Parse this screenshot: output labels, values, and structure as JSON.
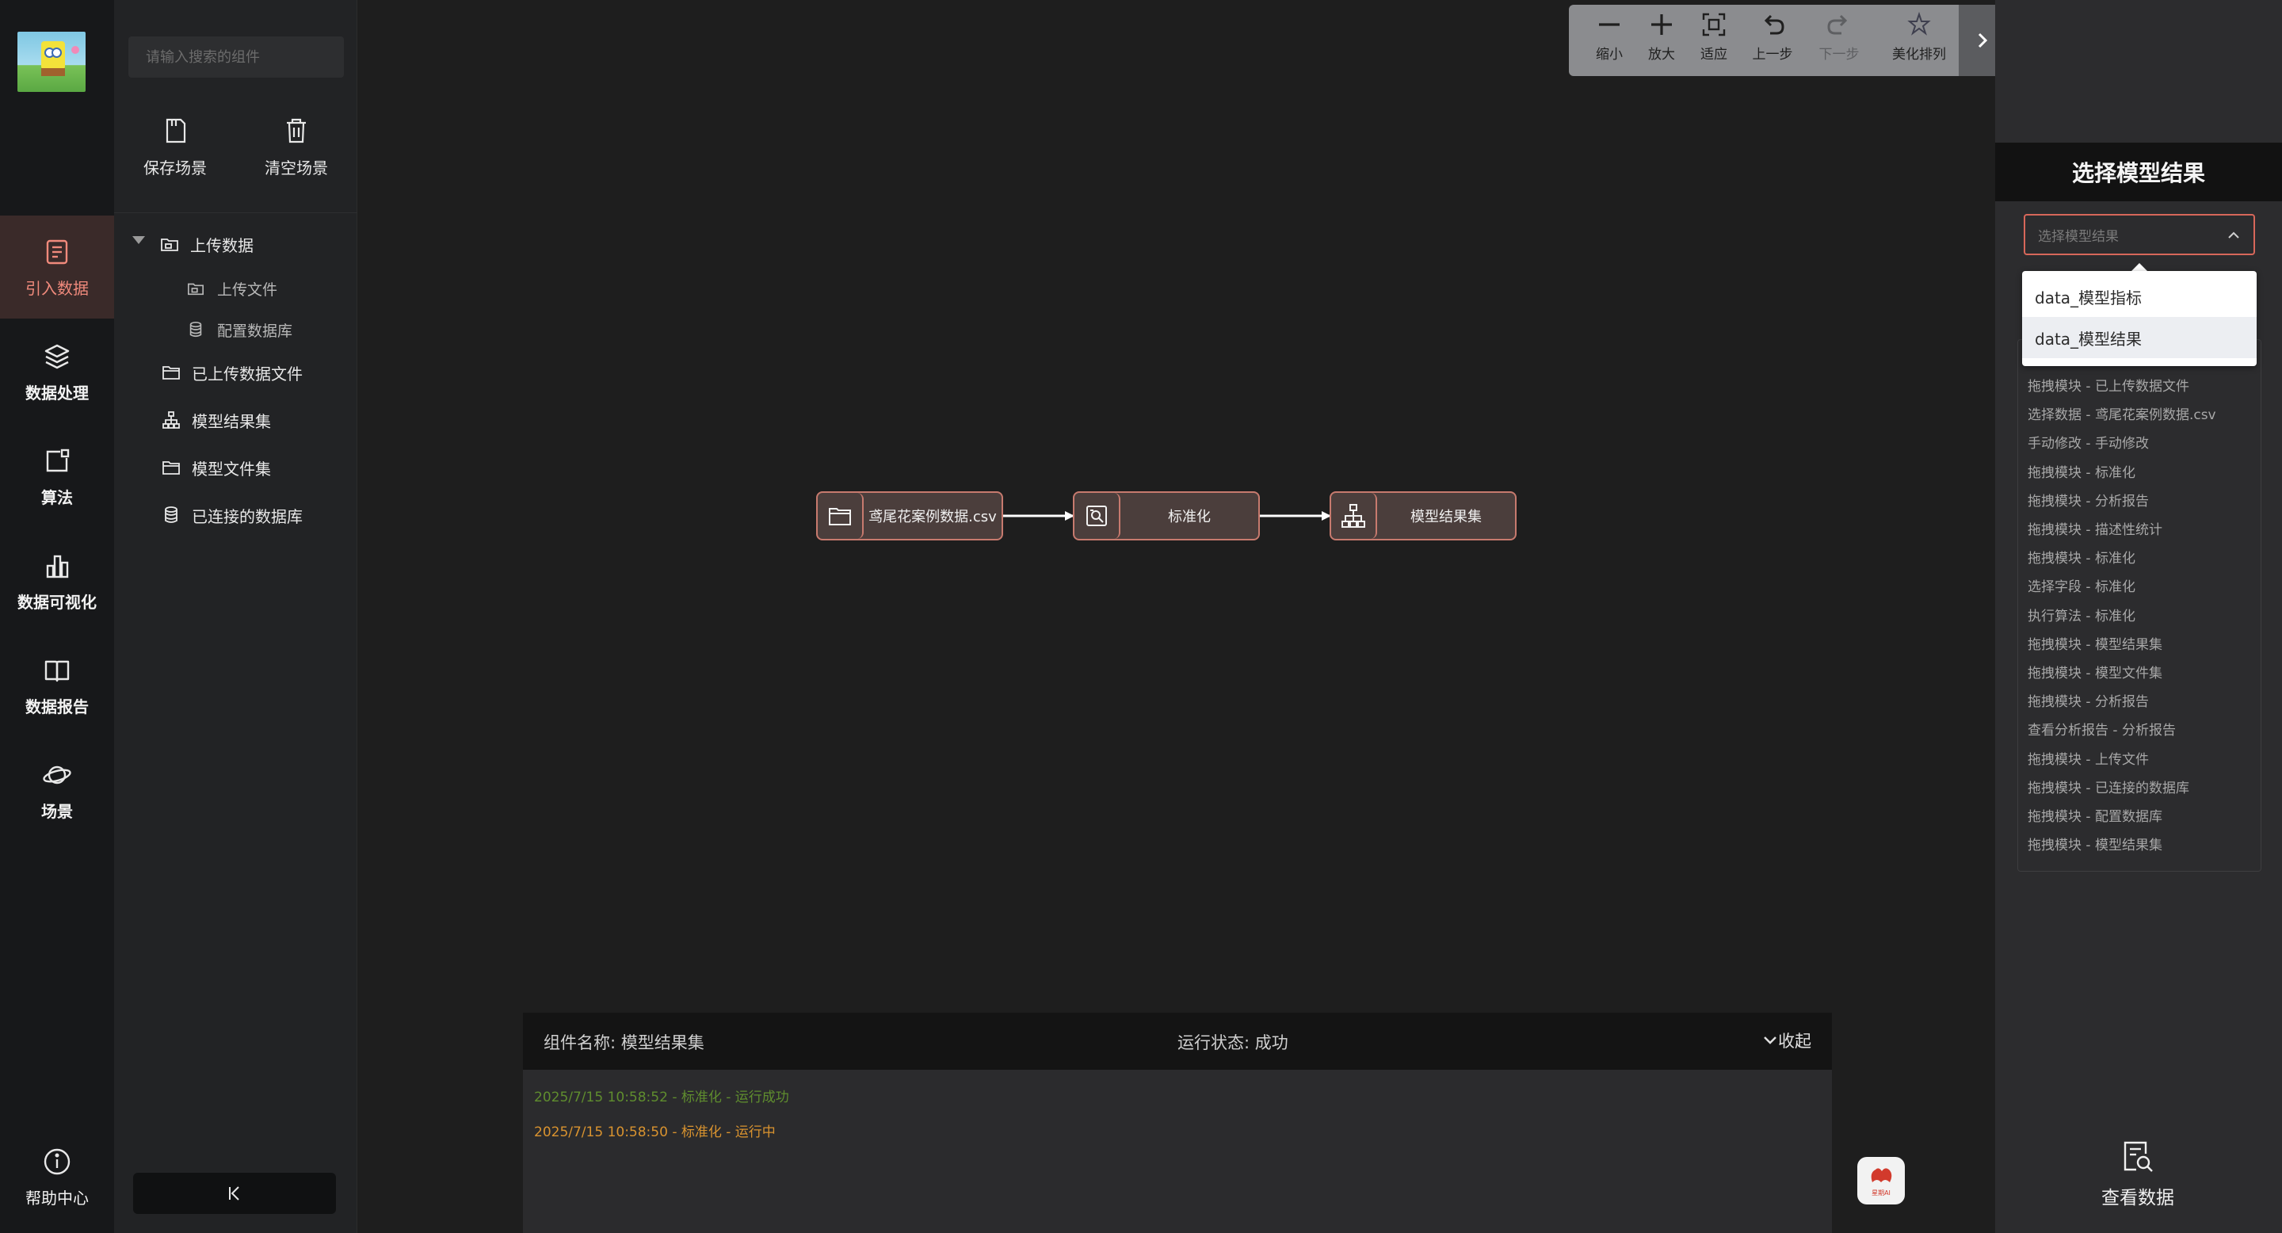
{
  "nav": {
    "items": [
      {
        "label": "引入数据",
        "icon": "import-data-icon"
      },
      {
        "label": "数据处理",
        "icon": "layers-icon"
      },
      {
        "label": "算法",
        "icon": "algorithm-icon"
      },
      {
        "label": "数据可视化",
        "icon": "bar-chart-icon"
      },
      {
        "label": "数据报告",
        "icon": "book-icon"
      },
      {
        "label": "场景",
        "icon": "planet-icon"
      }
    ],
    "active_index": 0,
    "help_label": "帮助中心"
  },
  "panel": {
    "search_placeholder": "请输入搜索的组件",
    "save_label": "保存场景",
    "clear_label": "清空场景",
    "tree": {
      "upload_data": "上传数据",
      "upload_file": "上传文件",
      "config_db": "配置数据库",
      "uploaded_files": "已上传数据文件",
      "model_results": "模型结果集",
      "model_files": "模型文件集",
      "connected_db": "已连接的数据库"
    }
  },
  "toolbar": {
    "zoom_out": "缩小",
    "zoom_in": "放大",
    "fit": "适应",
    "undo": "上一步",
    "redo": "下一步",
    "beautify": "美化排列"
  },
  "flow": {
    "nodes": [
      {
        "label": "鸢尾花案例数据.csv",
        "icon": "folder-icon"
      },
      {
        "label": "标准化",
        "icon": "search-document-icon"
      },
      {
        "label": "模型结果集",
        "icon": "hierarchy-icon"
      }
    ]
  },
  "log": {
    "component_name": "组件名称: 模型结果集",
    "run_status": "运行状态: 成功",
    "collapse_label": "收起",
    "lines": [
      {
        "text": "2025/7/15 10:58:52 - 标准化 - 运行成功",
        "color": "#5f8d2e"
      },
      {
        "text": "2025/7/15 10:58:50 - 标准化 - 运行中",
        "color": "#d9932f"
      }
    ]
  },
  "badge": {
    "label": "星期AI"
  },
  "right_panel": {
    "title": "选择模型结果",
    "select_placeholder": "选择模型结果",
    "options": [
      "data_模型指标",
      "data_模型结果"
    ],
    "history": [
      "拖拽模块 - 已上传数据文件",
      "选择数据 - 鸢尾花案例数据.csv",
      "手动修改 - 手动修改",
      "拖拽模块 - 标准化",
      "拖拽模块 - 分析报告",
      "拖拽模块 - 描述性统计",
      "拖拽模块 - 标准化",
      "选择字段 - 标准化",
      "执行算法 - 标准化",
      "拖拽模块 - 模型结果集",
      "拖拽模块 - 模型文件集",
      "拖拽模块 - 分析报告",
      "查看分析报告 - 分析报告",
      "拖拽模块 - 上传文件",
      "拖拽模块 - 已连接的数据库",
      "拖拽模块 - 配置数据库",
      "拖拽模块 - 模型结果集"
    ],
    "view_data_label": "查看数据"
  }
}
